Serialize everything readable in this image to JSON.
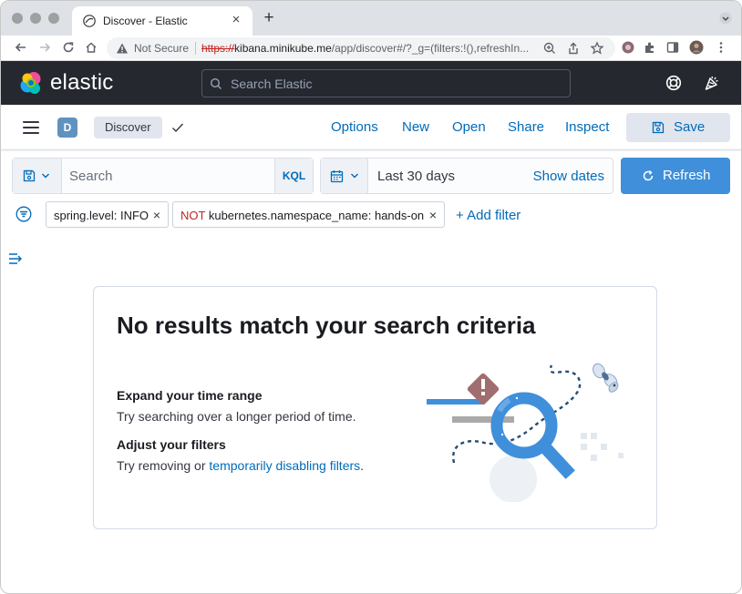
{
  "browser": {
    "tab_title": "Discover - Elastic",
    "security_label": "Not Secure",
    "url_scheme": "https://",
    "url_host": "kibana.minikube.me",
    "url_rest": "/app/discover#/?_g=(filters:!(),refreshIn..."
  },
  "header": {
    "brand": "elastic",
    "search_placeholder": "Search Elastic"
  },
  "topnav": {
    "space_initial": "D",
    "breadcrumb": "Discover",
    "links": {
      "options": "Options",
      "new": "New",
      "open": "Open",
      "share": "Share",
      "inspect": "Inspect"
    },
    "save_label": "Save"
  },
  "querybar": {
    "search_placeholder": "Search",
    "language": "KQL",
    "date_range": "Last 30 days",
    "show_dates": "Show dates",
    "refresh_label": "Refresh"
  },
  "filters": {
    "pills": [
      {
        "prefix": "",
        "text": "spring.level: INFO"
      },
      {
        "prefix": "NOT",
        "text": "kubernetes.namespace_name: hands-on"
      }
    ],
    "add_label": "+ Add filter"
  },
  "empty_state": {
    "title": "No results match your search criteria",
    "section1_title": "Expand your time range",
    "section1_text": "Try searching over a longer period of time.",
    "section2_title": "Adjust your filters",
    "section2_text": "Try removing or",
    "section2_link": "temporarily disabling filters",
    "section2_suffix": "."
  },
  "colors": {
    "header_bg": "#25282f",
    "link": "#006bb8",
    "primary": "#3f8fdb",
    "space_avatar": "#6092c0",
    "negation": "#bd271e"
  }
}
